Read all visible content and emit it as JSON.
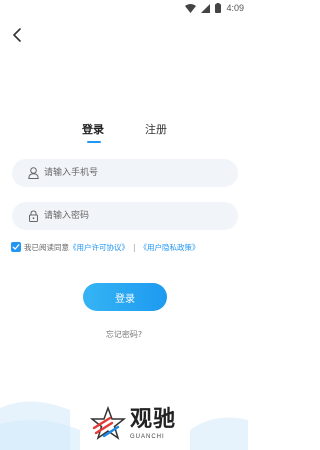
{
  "status_bar": {
    "time": "4:09"
  },
  "tabs": {
    "login": "登录",
    "register": "注册",
    "active": "login"
  },
  "form": {
    "phone_placeholder": "请输入手机号",
    "password_placeholder": "请输入密码",
    "phone_value": "",
    "password_value": ""
  },
  "agreement": {
    "checked": true,
    "prefix": "我已阅读同意",
    "user_agreement": "《用户许可协议》",
    "separator": "|",
    "privacy_policy": "《用户隐私政策》"
  },
  "login_button": "登录",
  "forgot_password": "忘记密码?",
  "watermark": {
    "title": "观驰",
    "subtitle": "GUANCHI"
  },
  "icons": {
    "back": "chevron-left-icon",
    "user": "user-icon",
    "lock": "lock-icon",
    "check": "check-icon",
    "wifi": "wifi-icon",
    "signal": "signal-icon",
    "battery": "battery-icon"
  },
  "colors": {
    "accent": "#2196f3",
    "button_start": "#35b4f4",
    "button_end": "#1e9af0",
    "field_bg": "#f1f4f8"
  }
}
